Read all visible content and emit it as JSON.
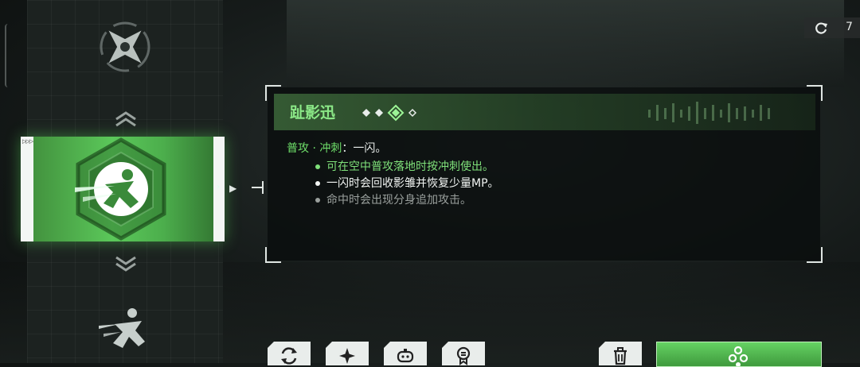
{
  "topbar": {
    "refresh_count": "7",
    "refresh_icon": "refresh-icon"
  },
  "skill_list": {
    "items": [
      {
        "icon": "shuriken-skill-icon",
        "state": "normal"
      },
      {
        "icon": "dash-skill-icon",
        "state": "selected"
      },
      {
        "icon": "dash-skill-icon",
        "state": "normal"
      }
    ],
    "scroll_up_icon": "double-chevron-up-icon",
    "scroll_down_icon": "double-chevron-down-icon"
  },
  "detail": {
    "skill_name": "趾影迅",
    "rank_current": 3,
    "rank_total": 4,
    "desc_label": "普攻 · 冲刺",
    "desc_suffix": "：一闪。",
    "bullets": [
      "可在空中普攻落地时按冲刺使出。",
      "一闪时会回收影雏并恢复少量MP。",
      "命中时会出现分身追加攻击。"
    ]
  },
  "colors": {
    "accent": "#6fe06a",
    "panel": "#0a0e0d",
    "button": "#e9edeb"
  },
  "bottom_buttons": [
    {
      "name": "swap-button",
      "icon": "swap-icon"
    },
    {
      "name": "sparkle-button",
      "icon": "sparkle-icon"
    },
    {
      "name": "controller-button",
      "icon": "gamepad-icon"
    },
    {
      "name": "medal-button",
      "icon": "medal-icon"
    },
    {
      "name": "discard-button",
      "icon": "trash-icon"
    },
    {
      "name": "equip-button",
      "icon": "hex-cluster-icon"
    }
  ]
}
